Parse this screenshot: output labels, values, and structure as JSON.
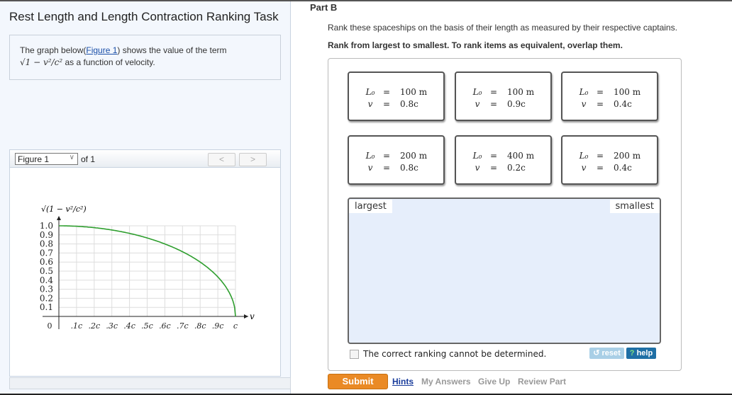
{
  "left": {
    "title": "Rest Length and Length Contraction Ranking Task",
    "intro_before": "The graph below(",
    "intro_link": "Figure 1",
    "intro_after": ") shows the value of the term",
    "intro_math": "√1 − v²/c²",
    "intro_tail": " as a function of velocity.",
    "figure_select": "Figure 1",
    "figure_of": "of 1",
    "prev_icon": "<",
    "next_icon": ">"
  },
  "chart_data": {
    "type": "line",
    "ylabel": "√(1 − v²/c²)",
    "xlabel": "v",
    "x_ticks": [
      "0",
      ".1c",
      ".2c",
      ".3c",
      ".4c",
      ".5c",
      ".6c",
      ".7c",
      ".8c",
      ".9c",
      "c"
    ],
    "y_ticks": [
      "0.1",
      "0.2",
      "0.3",
      "0.4",
      "0.5",
      "0.6",
      "0.7",
      "0.8",
      "0.9",
      "1.0"
    ],
    "xlim": [
      0,
      1
    ],
    "ylim": [
      0,
      1
    ],
    "grid": true,
    "series": [
      {
        "name": "sqrt(1-v^2/c^2)",
        "color": "#2e9e2e",
        "function": "sqrt(1-x^2)"
      }
    ]
  },
  "right": {
    "part": "Part B",
    "instruction1": "Rank these spaceships on the basis of their length as measured by their respective captains.",
    "instruction2": "Rank from largest to smallest. To rank items as equivalent, overlap them.",
    "cards": [
      {
        "L": "100 m",
        "v": "0.8c"
      },
      {
        "L": "100 m",
        "v": "0.9c"
      },
      {
        "L": "100 m",
        "v": "0.4c"
      },
      {
        "L": "200 m",
        "v": "0.8c"
      },
      {
        "L": "400 m",
        "v": "0.2c"
      },
      {
        "L": "200 m",
        "v": "0.4c"
      }
    ],
    "L_label": "L₀",
    "v_label": "v",
    "eq": "=",
    "largest": "largest",
    "smallest": "smallest",
    "cannot_determine": "The correct ranking cannot be determined.",
    "reset": "reset",
    "help": "help",
    "submit": "Submit",
    "links": [
      "Hints",
      "My Answers",
      "Give Up",
      "Review Part"
    ]
  }
}
